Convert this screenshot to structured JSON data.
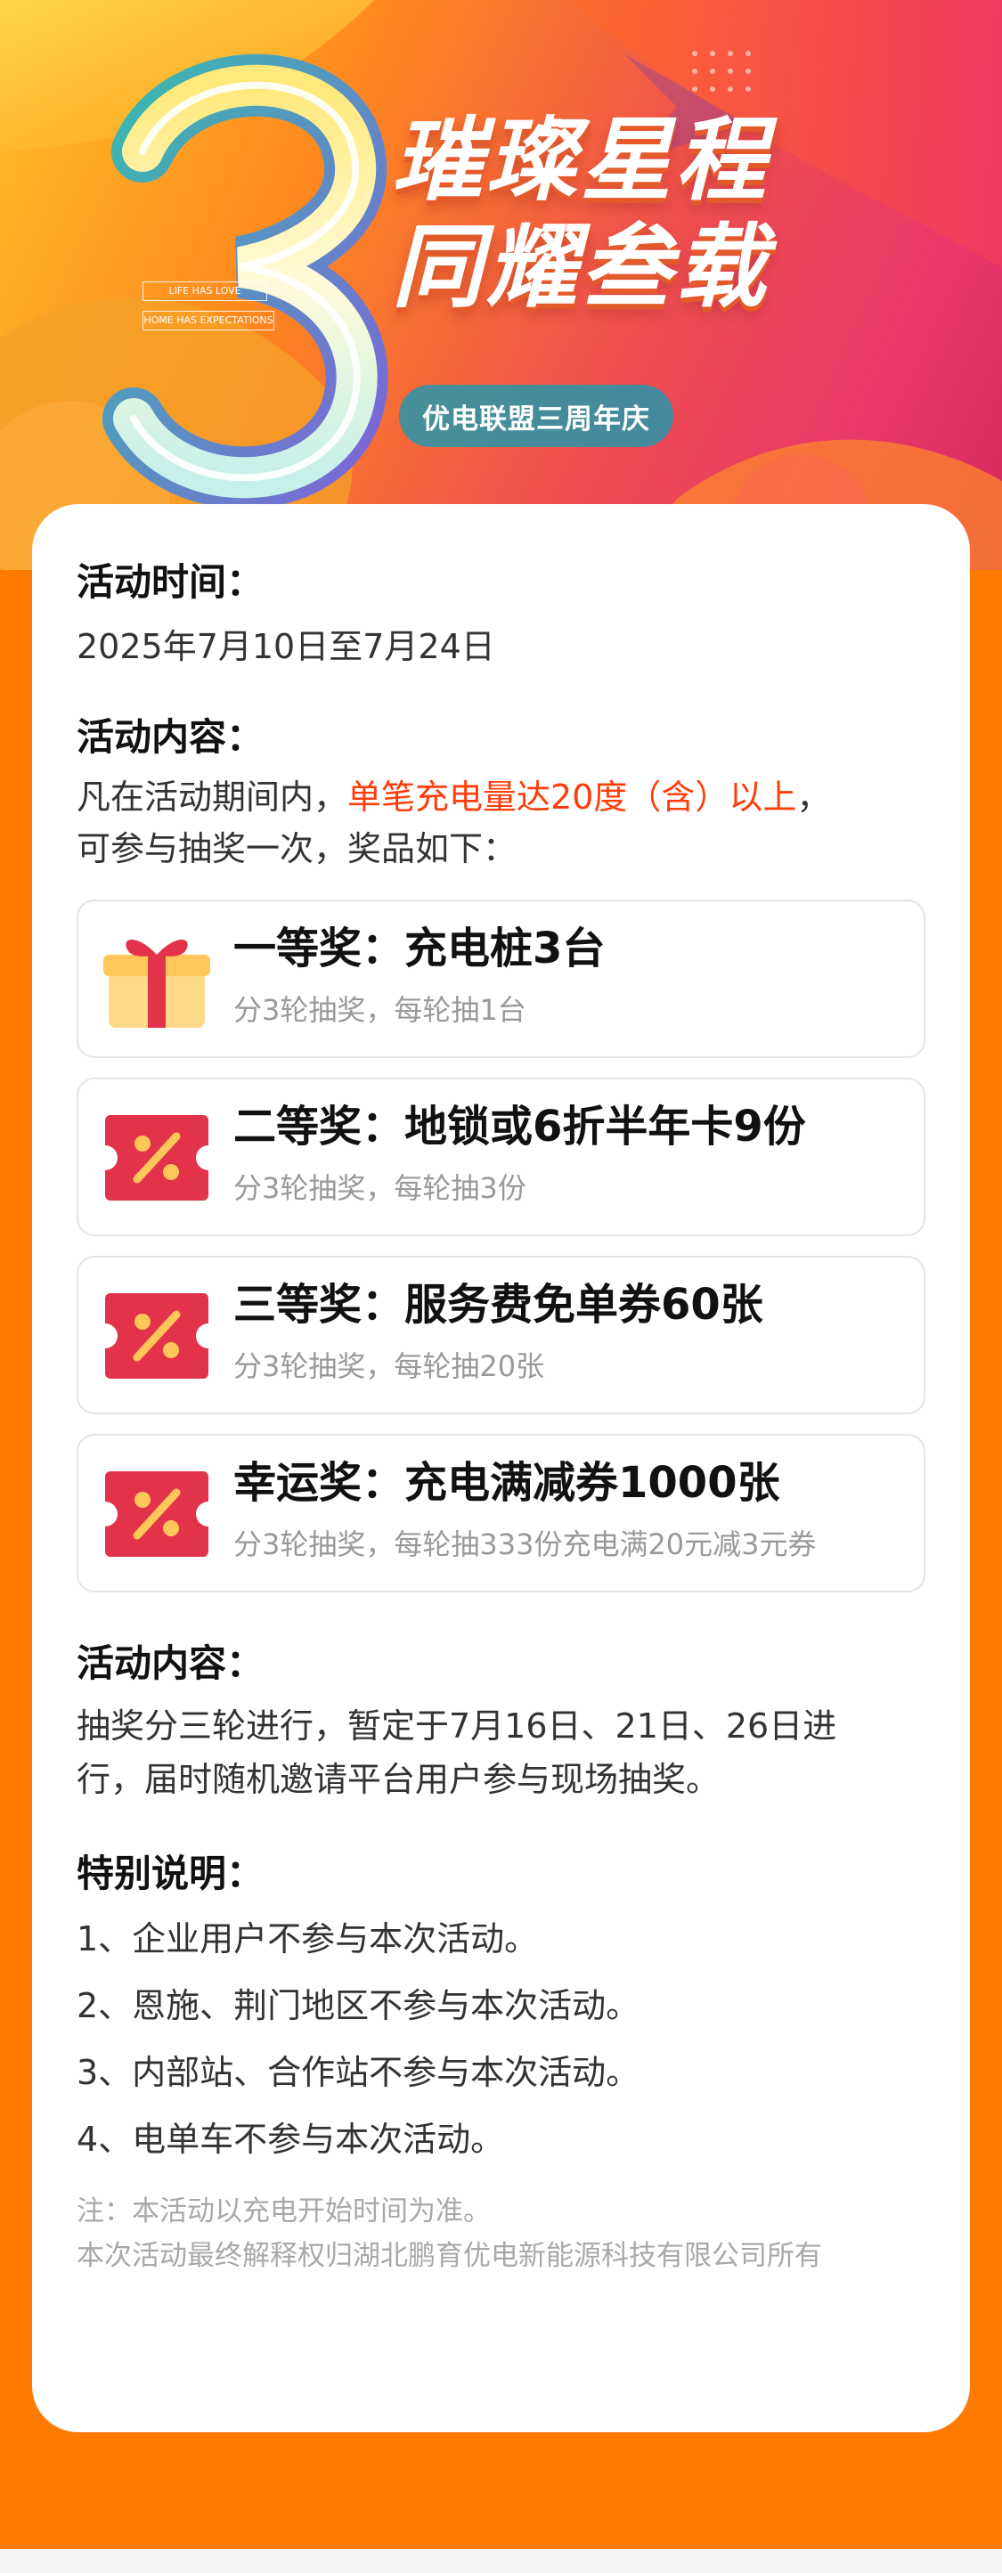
{
  "banner": {
    "numeral": "3",
    "title_line1": "璀璨星程",
    "title_line2": "同耀叁载",
    "subtitle": "优电联盟三周年庆",
    "english_tag1": "LIFE HAS LOVE",
    "english_tag2": "HOME HAS EXPECTATIONS",
    "colors": {
      "orange": "#ff7a00",
      "pink": "#e8376a",
      "teal": "#2896aa"
    }
  },
  "time_section": {
    "heading": "活动时间：",
    "value": "2025年7月10日至7月24日"
  },
  "content_section": {
    "heading": "活动内容：",
    "text_before": "凡在活动期间内，",
    "text_highlight": "单笔充电量达20度（含）以上",
    "text_after": "，",
    "text_line2": "可参与抽奖一次，奖品如下：",
    "highlight_color": "#ff3d0a"
  },
  "prizes": [
    {
      "icon": "gift-icon",
      "title": "一等奖：充电桩3台",
      "sub": "分3轮抽奖，每轮抽1台"
    },
    {
      "icon": "coupon-percent-icon",
      "title": "二等奖：地锁或6折半年卡9份",
      "sub": "分3轮抽奖，每轮抽3份"
    },
    {
      "icon": "coupon-percent-icon",
      "title": "三等奖：服务费免单券60张",
      "sub": "分3轮抽奖，每轮抽20张"
    },
    {
      "icon": "coupon-percent-icon",
      "title": "幸运奖：充电满减券1000张",
      "sub": "分3轮抽奖，每轮抽333份充电满20元减3元券"
    }
  ],
  "draw_section": {
    "heading": "活动内容：",
    "line1": "抽奖分三轮进行，暂定于7月16日、21日、26日进",
    "line2": "行，届时随机邀请平台用户参与现场抽奖。"
  },
  "special_section": {
    "heading": "特别说明：",
    "items": [
      "1、企业用户不参与本次活动。",
      "2、恩施、荆门地区不参与本次活动。",
      "3、内部站、合作站不参与本次活动。",
      "4、电单车不参与本次活动。"
    ]
  },
  "notes": {
    "line1": "注：本活动以充电开始时间为准。",
    "line2": "本次活动最终解释权归湖北鹏育优电新能源科技有限公司所有"
  }
}
